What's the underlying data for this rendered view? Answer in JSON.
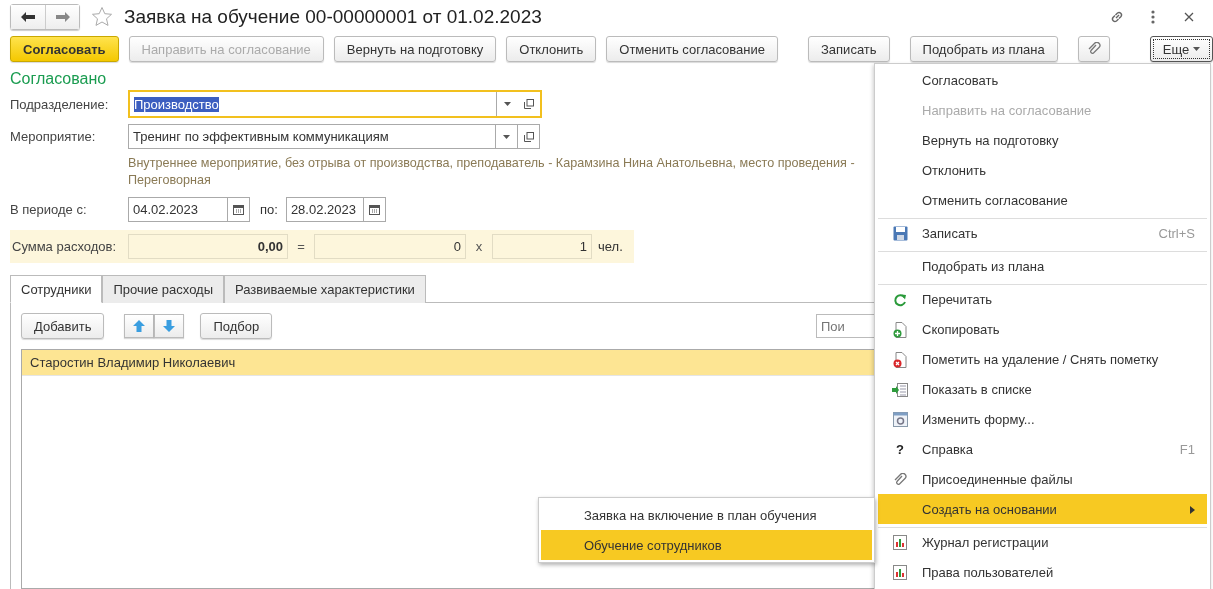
{
  "window": {
    "title": "Заявка на обучение 00-00000001 от 01.02.2023"
  },
  "toolbar": [
    {
      "label": "Согласовать",
      "kind": "primary",
      "disabled": false
    },
    {
      "label": "Направить на согласование",
      "kind": "normal",
      "disabled": true
    },
    {
      "label": "Вернуть на подготовку",
      "kind": "normal",
      "disabled": false
    },
    {
      "label": "Отклонить",
      "kind": "normal",
      "disabled": false
    },
    {
      "label": "Отменить согласование",
      "kind": "normal",
      "disabled": false
    },
    {
      "label": "Записать",
      "kind": "normal",
      "disabled": false
    },
    {
      "label": "Подобрать из плана",
      "kind": "normal",
      "disabled": false
    },
    {
      "kind": "attach"
    },
    {
      "label": "Еще",
      "kind": "more",
      "disabled": false
    }
  ],
  "status": "Согласовано",
  "department": {
    "label": "Подразделение:",
    "value": "Производство",
    "focused": true
  },
  "event": {
    "label": "Мероприятие:",
    "value": "Тренинг по эффективным коммуникациям",
    "description": "Внутреннее мероприятие, без отрыва от производства, преподаватель - Карамзина Нина Анатольевна, место проведения - Переговорная"
  },
  "period": {
    "label": "В периоде с:",
    "from": "04.02.2023",
    "to_label": "по:",
    "to": "28.02.2023"
  },
  "costs": {
    "label": "Сумма расходов:",
    "total": "0,00",
    "equals": "=",
    "per_person": "0",
    "times": "x",
    "count": "1",
    "unit": "чел."
  },
  "tabs": [
    {
      "label": "Сотрудники",
      "selected": true
    },
    {
      "label": "Прочие расходы",
      "selected": false
    },
    {
      "label": "Развиваемые характеристики",
      "selected": false
    }
  ],
  "table_toolbar": {
    "add": "Добавить",
    "pick": "Подбор",
    "search_placeholder": "Пои"
  },
  "rows": [
    {
      "name": "Старостин Владимир Николаевич",
      "selected": true
    }
  ],
  "menu": [
    {
      "label": "Согласовать",
      "kind": "plain",
      "disabled": false,
      "selected": false,
      "separator_before": false
    },
    {
      "label": "Направить на согласование",
      "kind": "plain",
      "disabled": true,
      "selected": false,
      "separator_before": false
    },
    {
      "label": "Вернуть на подготовку",
      "kind": "plain",
      "disabled": false,
      "selected": false,
      "separator_before": false
    },
    {
      "label": "Отклонить",
      "kind": "plain",
      "disabled": false,
      "selected": false,
      "separator_before": false
    },
    {
      "label": "Отменить согласование",
      "kind": "plain",
      "disabled": false,
      "selected": false,
      "separator_before": false
    },
    {
      "label": "Записать",
      "kind": "save",
      "shortcut": "Ctrl+S",
      "disabled": false,
      "selected": false,
      "separator_before": true
    },
    {
      "label": "Подобрать из плана",
      "kind": "plain",
      "disabled": false,
      "selected": false,
      "separator_before": true
    },
    {
      "label": "Перечитать",
      "kind": "reload",
      "disabled": false,
      "selected": false,
      "separator_before": true
    },
    {
      "label": "Скопировать",
      "kind": "copy",
      "disabled": false,
      "selected": false,
      "separator_before": false
    },
    {
      "label": "Пометить на удаление / Снять пометку",
      "kind": "delete",
      "disabled": false,
      "selected": false,
      "separator_before": false
    },
    {
      "label": "Показать в списке",
      "kind": "list",
      "disabled": false,
      "selected": false,
      "separator_before": false
    },
    {
      "label": "Изменить форму...",
      "kind": "form",
      "disabled": false,
      "selected": false,
      "separator_before": false
    },
    {
      "label": "Справка",
      "kind": "help",
      "icon_text": "?",
      "shortcut": "F1",
      "disabled": false,
      "selected": false,
      "separator_before": false
    },
    {
      "label": "Присоединенные файлы",
      "kind": "attach",
      "disabled": false,
      "selected": false,
      "separator_before": false
    },
    {
      "label": "Создать на основании",
      "kind": "submenu",
      "disabled": false,
      "selected": true,
      "separator_before": false
    },
    {
      "label": "Журнал регистрации",
      "kind": "report",
      "disabled": false,
      "selected": false,
      "separator_before": true
    },
    {
      "label": "Права пользователей",
      "kind": "report",
      "disabled": false,
      "selected": false,
      "separator_before": false
    }
  ],
  "submenu": [
    {
      "label": "Заявка на включение в план обучения",
      "selected": false
    },
    {
      "label": "Обучение сотрудников",
      "selected": true
    }
  ]
}
